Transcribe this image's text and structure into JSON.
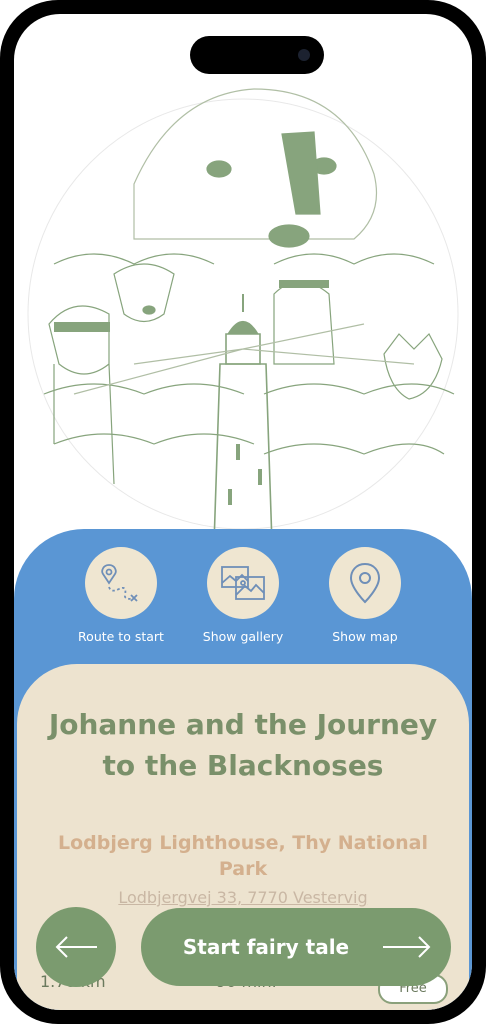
{
  "actions": [
    {
      "label": "Route to start",
      "icon": "route-icon"
    },
    {
      "label": "Show gallery",
      "icon": "gallery-icon"
    },
    {
      "label": "Show map",
      "icon": "map-pin-icon"
    }
  ],
  "story": {
    "title": "Johanne and the Journey to the Blacknoses",
    "location": "Lodbjerg Lighthouse, Thy National Park",
    "address": "Lodbjergvej 33, 7770 Vestervig"
  },
  "stats": {
    "distance": "1.70 km",
    "duration": "90 min.",
    "badge": "Free"
  },
  "buttons": {
    "start": "Start fairy tale",
    "back_icon": "arrow-left-icon",
    "start_icon": "arrow-right-icon"
  },
  "colors": {
    "blue": "#5a96d4",
    "cream": "#ede3cf",
    "green": "#7b9b6f",
    "title_green": "#7a906a",
    "location_tan": "#d4b08e"
  }
}
